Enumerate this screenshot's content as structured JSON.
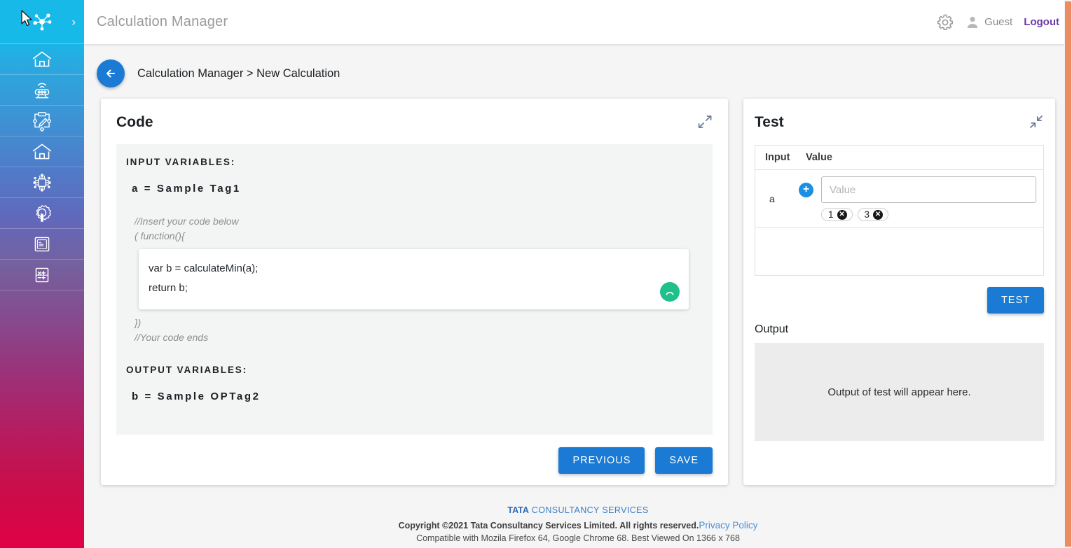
{
  "sidebar": {
    "logo_icon": "network-molecule-logo-icon",
    "expand_chevron": "›",
    "items": [
      {
        "icon": "home-icon",
        "name": "sidebar-item-home"
      },
      {
        "icon": "iot-device-icon",
        "name": "sidebar-item-devices"
      },
      {
        "icon": "circuit-edit-icon",
        "name": "sidebar-item-configure"
      },
      {
        "icon": "home-icon",
        "name": "sidebar-item-dashboard"
      },
      {
        "icon": "chip-processor-icon",
        "name": "sidebar-item-processor"
      },
      {
        "icon": "gear-wrench-icon",
        "name": "sidebar-item-maintenance"
      },
      {
        "icon": "console-terminal-icon",
        "name": "sidebar-item-console"
      },
      {
        "icon": "calculator-icon",
        "name": "sidebar-item-calculation"
      }
    ]
  },
  "topbar": {
    "app_title": "Calculation Manager",
    "settings_icon": "gear-icon",
    "user_icon": "person-icon",
    "user_label": "Guest",
    "logout_label": "Logout"
  },
  "breadcrumb": {
    "back_icon": "arrow-left-icon",
    "text": "Calculation Manager > New Calculation"
  },
  "code_panel": {
    "title": "Code",
    "expand_icon": "expand-arrows-icon",
    "input_variables_label": "INPUT VARIABLES:",
    "input_variable": "a = Sample Tag1",
    "comment_top_line1": "//Insert your code below",
    "comment_top_line2": "( function(){",
    "editor_lines": [
      "var b = calculateMin(a);",
      "return b;"
    ],
    "run_icon": "arc-spinner-icon",
    "comment_bottom_line1": "})",
    "comment_bottom_line2": "//Your code ends",
    "output_variables_label": "OUTPUT VARIABLES:",
    "output_variable": "b = Sample OPTag2",
    "previous_label": "PREVIOUS",
    "save_label": "SAVE"
  },
  "test_panel": {
    "title": "Test",
    "collapse_icon": "collapse-arrows-icon",
    "columns": [
      "Input",
      "Value"
    ],
    "row_input": "a",
    "add_icon": "plus-icon",
    "value_placeholder": "Value",
    "value_current": "",
    "chips": [
      "1",
      "3"
    ],
    "chip_remove_icon": "close-circle-icon",
    "test_label": "TEST",
    "output_label": "Output",
    "output_placeholder": "Output of test will appear here."
  },
  "footer": {
    "brand_bold": "TATA",
    "brand_rest": " CONSULTANCY SERVICES",
    "copyright": "Copyright ©2021 Tata Consultancy Services Limited. All rights reserved.",
    "privacy_link": "Privacy Policy",
    "compatibility": "Compatible with Mozila Firefox 64, Google Chrome 68. Best Viewed On 1366 x 768"
  },
  "colors": {
    "accent_blue": "#1a7ad4",
    "logout_purple": "#6a3ba6",
    "run_green": "#1fc08b",
    "scrollbar_orange": "#ee8b62",
    "sidebar_top": "#17b9e8",
    "sidebar_bottom": "#e00046"
  }
}
